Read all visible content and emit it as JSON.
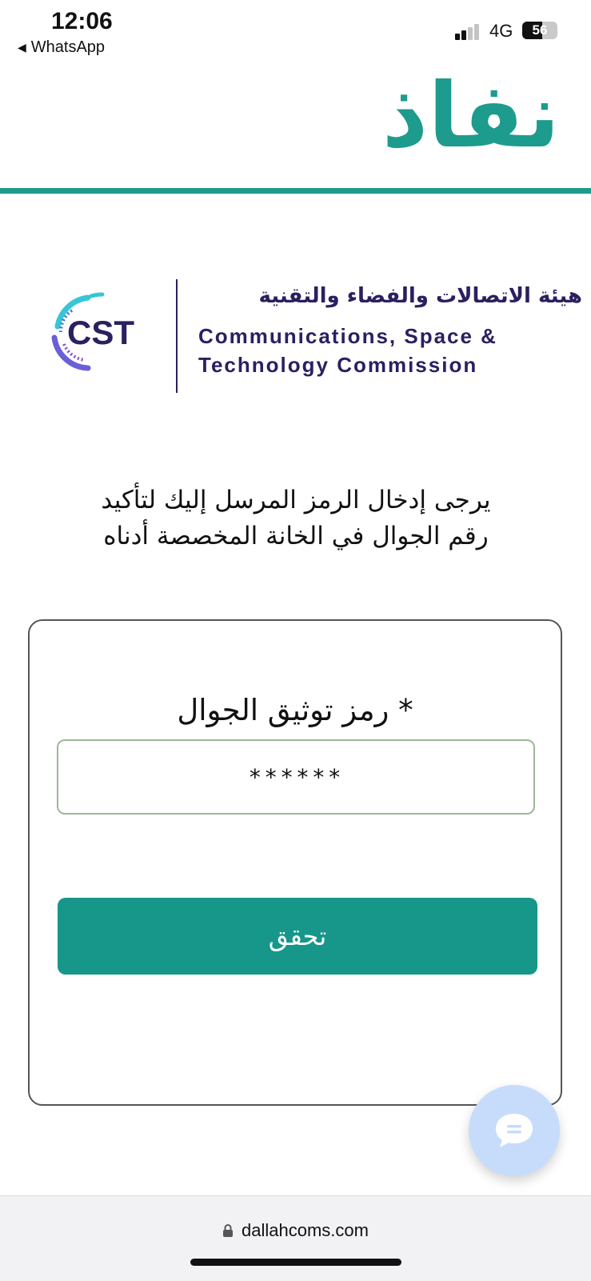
{
  "status_bar": {
    "time": "12:06",
    "back_app": "WhatsApp",
    "back_glyph": "◀",
    "network": "4G",
    "battery_percent": 56,
    "battery_label": "56",
    "signal_bars_active": 2,
    "signal_bars_total": 4
  },
  "header": {
    "logo_text": "نفاذ",
    "brand_color": "#1d9b8c"
  },
  "cst": {
    "mark_text": "CST",
    "arabic_name": "هيئة الاتصالات والفضاء والتقنية",
    "english_line1": "Communications, Space &",
    "english_line2": "Technology Commission",
    "color": "#2a2060"
  },
  "instruction": {
    "line1": "يرجى إدخال الرمز المرسل إليك لتأكيد",
    "line2": "رقم الجوال في الخانة المخصصة أدناه"
  },
  "form": {
    "field_label": "* رمز توثيق الجوال",
    "code_value": "******",
    "submit_label": "تحقق",
    "button_color": "#16978a"
  },
  "chat": {
    "icon": "chat-icon",
    "color": "#c7dcfb"
  },
  "browser": {
    "url": "dallahcoms.com",
    "icon": "lock-icon"
  }
}
